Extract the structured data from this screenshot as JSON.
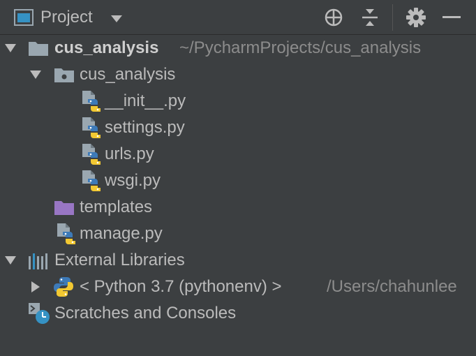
{
  "header": {
    "title": "Project"
  },
  "tree": {
    "root": {
      "label": "cus_analysis",
      "path": "~/PycharmProjects/cus_analysis"
    },
    "package": {
      "label": "cus_analysis"
    },
    "files": [
      {
        "label": "__init__.py"
      },
      {
        "label": "settings.py"
      },
      {
        "label": "urls.py"
      },
      {
        "label": "wsgi.py"
      }
    ],
    "templates": {
      "label": "templates"
    },
    "manage": {
      "label": "manage.py"
    },
    "external": {
      "label": "External Libraries"
    },
    "python_env": {
      "label": "< Python 3.7 (pythonenv) >",
      "path": "/Users/chahunlee"
    },
    "scratches": {
      "label": "Scratches and Consoles"
    }
  },
  "colors": {
    "background": "#3c3f41",
    "text": "#bbbbbb",
    "muted": "#8c8c8c",
    "folder_grey": "#9aa7b0",
    "folder_purple": "#9876c4",
    "python_blue": "#3d7ab8",
    "python_yellow": "#f2c832",
    "clock_blue": "#3592c4"
  }
}
